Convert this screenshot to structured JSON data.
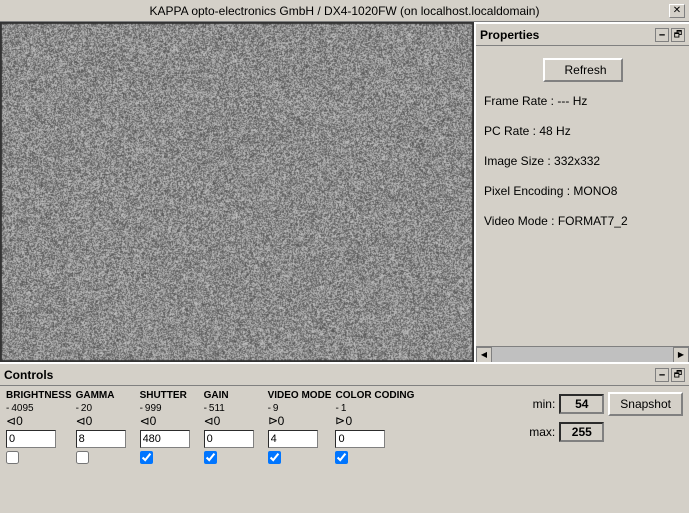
{
  "window": {
    "title": "KAPPA opto-electronics GmbH / DX4-1020FW (on localhost.localdomain)",
    "close_label": "✕"
  },
  "properties": {
    "panel_title": "Properties",
    "refresh_label": "Refresh",
    "frame_rate_label": "Frame Rate :",
    "frame_rate_value": "--- Hz",
    "pc_rate_label": "PC Rate :",
    "pc_rate_value": "48 Hz",
    "image_size_label": "Image Size :",
    "image_size_value": "332x332",
    "pixel_encoding_label": "Pixel Encoding :",
    "pixel_encoding_value": "MONO8",
    "video_mode_label": "Video Mode :",
    "video_mode_value": "FORMAT7_2",
    "minimize_icon": "🗕",
    "restore_icon": "🗗"
  },
  "controls": {
    "panel_title": "Controls",
    "brightness": {
      "label": "BRIGHTNESS",
      "min": "0",
      "max": "4095",
      "current_top": "0",
      "input_value": "0",
      "checkbox_checked": false
    },
    "gamma": {
      "label": "GAMMA",
      "min": "0",
      "max": "20",
      "current_top": "0",
      "input_value": "8",
      "checkbox_checked": false
    },
    "shutter": {
      "label": "SHUTTER",
      "min": "0",
      "max": "999",
      "current_top": "0",
      "input_value": "480",
      "checkbox_checked": true
    },
    "gain": {
      "label": "GAIN",
      "min": "0",
      "max": "511",
      "current_top": "0",
      "input_value": "0",
      "checkbox_checked": true
    },
    "video_mode": {
      "label": "VIDEO MODE",
      "min": "0",
      "max": "9",
      "current_top": "0",
      "input_value": "4",
      "checkbox_checked": true
    },
    "color_coding": {
      "label": "COLOR CODING",
      "min": "0",
      "max": "1",
      "current_top": "0",
      "input_value": "0",
      "checkbox_checked": true
    },
    "min_label": "min:",
    "min_value": "54",
    "max_label": "max:",
    "max_value": "255",
    "snapshot_label": "Snapshot"
  }
}
